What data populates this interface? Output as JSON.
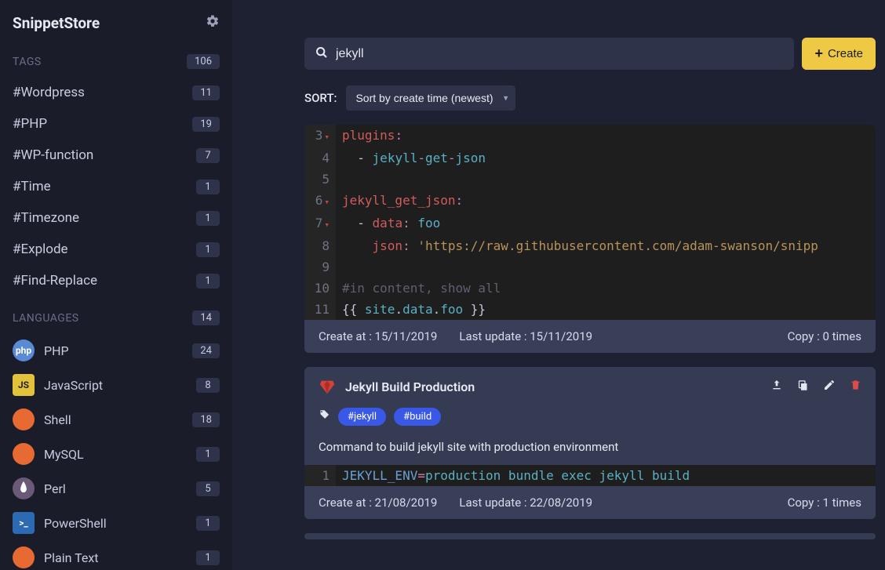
{
  "app": {
    "title": "SnippetStore"
  },
  "sidebar": {
    "tags_label": "TAGS",
    "tags_count": "106",
    "tags": [
      {
        "name": "#Wordpress",
        "count": "11"
      },
      {
        "name": "#PHP",
        "count": "19"
      },
      {
        "name": "#WP-function",
        "count": "7"
      },
      {
        "name": "#Time",
        "count": "1"
      },
      {
        "name": "#Timezone",
        "count": "1"
      },
      {
        "name": "#Explode",
        "count": "1"
      },
      {
        "name": "#Find-Replace",
        "count": "1"
      }
    ],
    "languages_label": "LANGUAGES",
    "languages_count": "14",
    "languages": [
      {
        "name": "PHP",
        "count": "24",
        "icon_text": "php",
        "bg": "#5a8ad6"
      },
      {
        "name": "JavaScript",
        "count": "8",
        "icon_text": "JS",
        "bg": "#e2c23a"
      },
      {
        "name": "Shell",
        "count": "18",
        "icon_text": "</>",
        "bg": "#e86a33"
      },
      {
        "name": "MySQL",
        "count": "1",
        "icon_text": "</>",
        "bg": "#e86a33"
      },
      {
        "name": "Perl",
        "count": "5",
        "icon_text": "",
        "bg": "#6b5a77"
      },
      {
        "name": "PowerShell",
        "count": "1",
        "icon_text": ">_",
        "bg": "#2c6bb3"
      },
      {
        "name": "Plain Text",
        "count": "1",
        "icon_text": "</>",
        "bg": "#e86a33"
      }
    ]
  },
  "search": {
    "value": "jekyll"
  },
  "create_label": "Create",
  "sort": {
    "label": "SORT:",
    "selected": "Sort by create time (newest)"
  },
  "snippets": [
    {
      "code_lines": [
        {
          "n": "3",
          "fold": true,
          "html": "<span class='tok-key'>plugins</span><span class='tok-punc'>:</span>"
        },
        {
          "n": "4",
          "html": "  <span class='tok-dash'>-</span> <span class='tok-ident'>jekyll</span><span class='tok-punc'>-</span><span class='tok-ident'>get</span><span class='tok-punc'>-</span><span class='tok-ident'>json</span>"
        },
        {
          "n": "5",
          "html": ""
        },
        {
          "n": "6",
          "fold": true,
          "html": "<span class='tok-key'>jekyll_get_json</span><span class='tok-punc'>:</span>"
        },
        {
          "n": "7",
          "fold": true,
          "html": "  <span class='tok-dash'>-</span> <span class='tok-key'>data</span><span class='tok-punc'>:</span> <span class='tok-ident'>foo</span>"
        },
        {
          "n": "8",
          "html": "    <span class='tok-key'>json</span><span class='tok-punc'>:</span> <span class='tok-str'>'https://raw.githubusercontent.com/adam-swanson/snipp</span>"
        },
        {
          "n": "9",
          "html": ""
        },
        {
          "n": "10",
          "html": "<span class='tok-comment'>#in content, show all</span>"
        },
        {
          "n": "11",
          "html": "<span class='tok-brace'>{{</span> <span class='tok-ident'>site</span><span class='tok-brace'>.</span><span class='tok-ident'>data</span><span class='tok-brace'>.</span><span class='tok-ident'>foo</span> <span class='tok-brace'>}}</span>"
        }
      ],
      "created": "Create at : 15/11/2019",
      "updated": "Last update : 15/11/2019",
      "copy": "Copy : 0 times"
    },
    {
      "title": "Jekyll Build Production",
      "tags": [
        "#jekyll",
        "#build"
      ],
      "description": "Command to build jekyll site with production environment",
      "code_lines": [
        {
          "n": "1",
          "html": "<span class='tok-var'>JEKYLL_ENV</span><span class='tok-eq'>=</span><span class='tok-ident'>production bundle exec jekyll build</span>"
        }
      ],
      "created": "Create at : 21/08/2019",
      "updated": "Last update : 22/08/2019",
      "copy": "Copy : 1 times"
    }
  ]
}
